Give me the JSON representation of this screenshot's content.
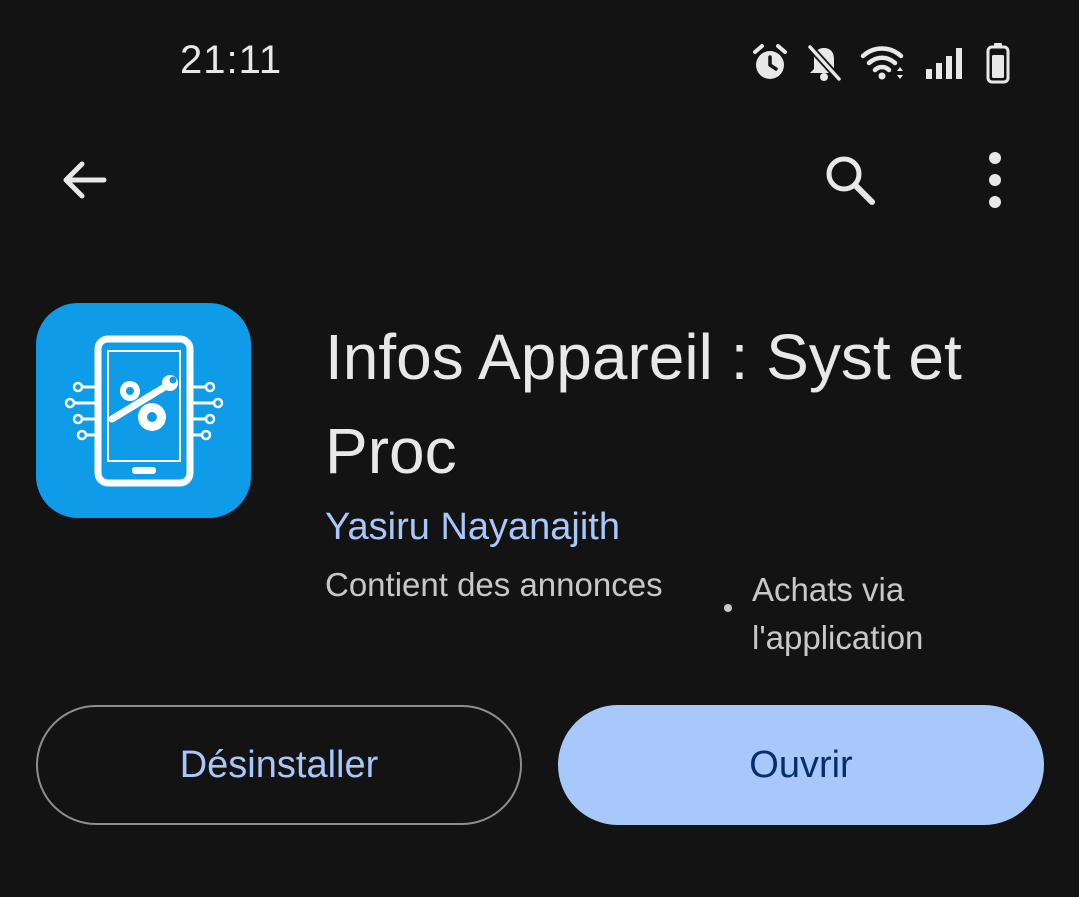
{
  "status_bar": {
    "time": "21:11",
    "icons": [
      "alarm-icon",
      "mute-icon",
      "wifi-icon",
      "signal-icon",
      "battery-icon"
    ]
  },
  "toolbar": {
    "icons": [
      "back-arrow-icon",
      "search-icon",
      "more-vert-icon"
    ]
  },
  "app": {
    "title": "Infos Appareil : Syst et Proc",
    "developer": "Yasiru Nayanajith",
    "contains_ads": "Contient des annonces",
    "in_app_purchases": "Achats via l'application",
    "icon": "phone-settings-icon"
  },
  "actions": {
    "uninstall_label": "Désinstaller",
    "open_label": "Ouvrir"
  },
  "colors": {
    "background": "#131313",
    "accent": "#a8c7fa",
    "primary_button_text": "#062e6f",
    "app_icon_bg": "#0e9be8"
  }
}
